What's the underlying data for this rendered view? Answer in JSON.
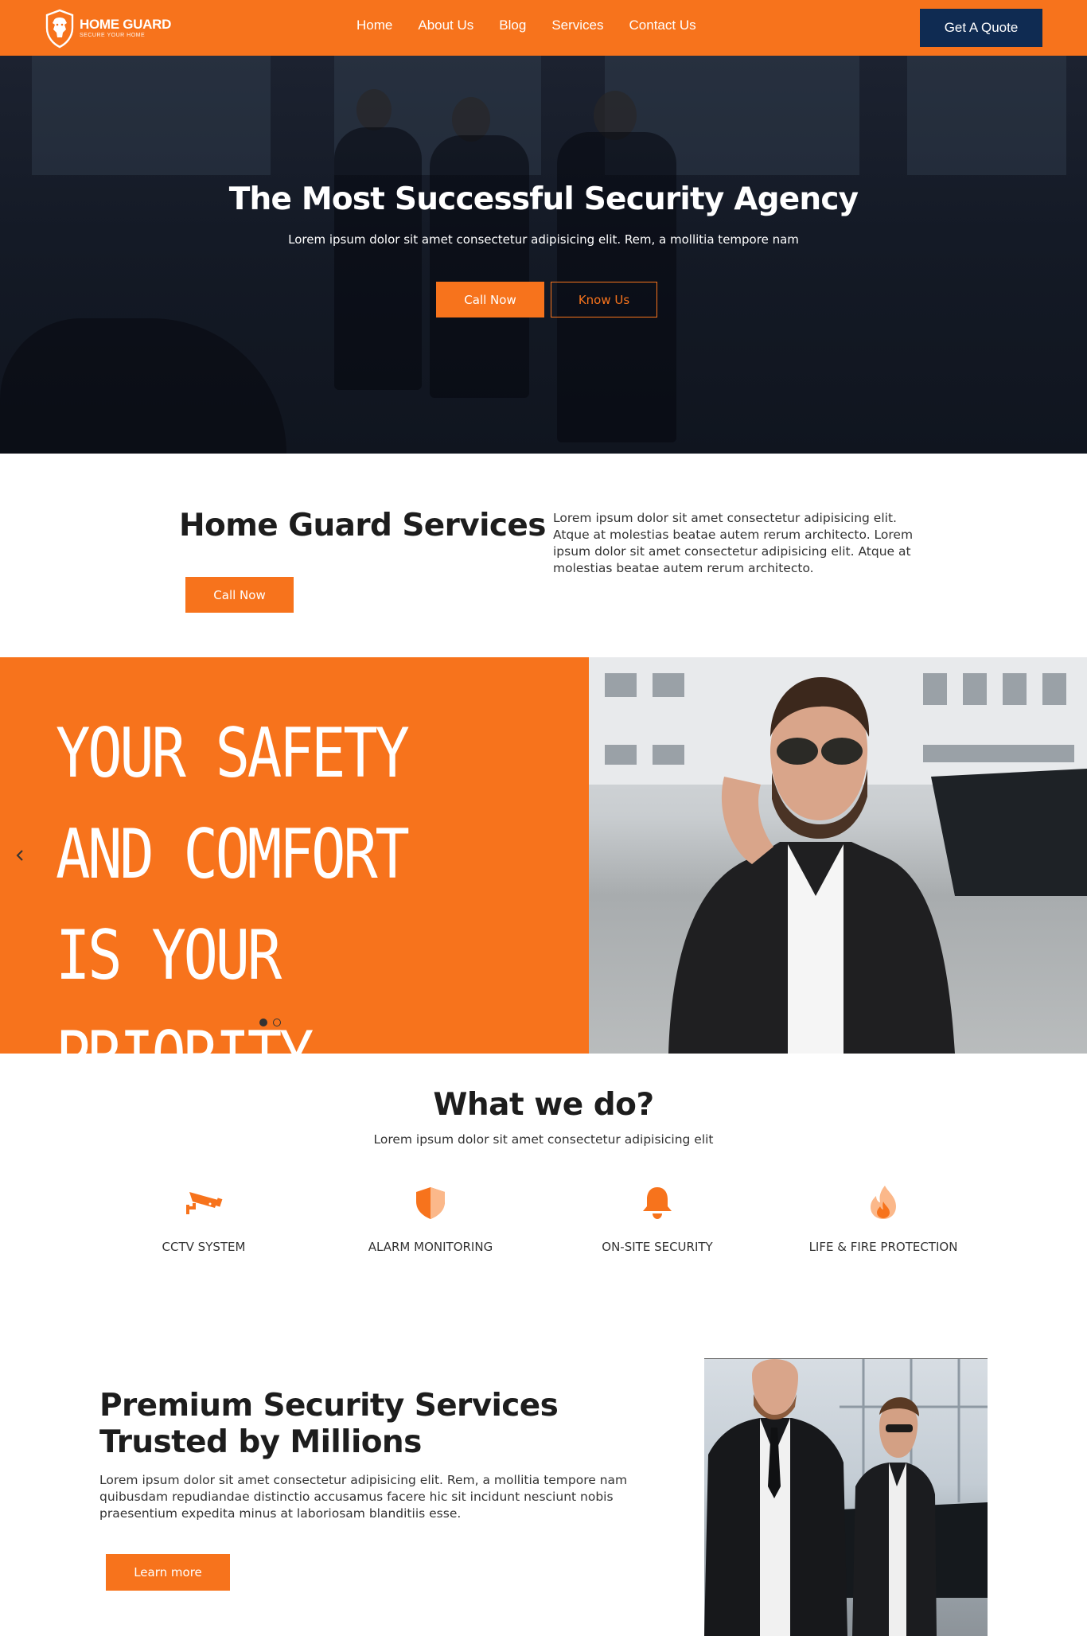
{
  "brand": {
    "name": "HOME GUARD",
    "tagline": "SECURE YOUR HOME",
    "accent": "#f7731c",
    "navy": "#0f2b52"
  },
  "nav": {
    "links": [
      "Home",
      "About Us",
      "Blog",
      "Services",
      "Contact Us"
    ],
    "quote_label": "Get A Quote"
  },
  "hero": {
    "title": "The Most Successful Security Agency",
    "subtitle": "Lorem ipsum dolor sit amet consectetur adipisicing elit. Rem, a mollitia tempore nam",
    "primary_cta": "Call Now",
    "secondary_cta": "Know Us"
  },
  "services_intro": {
    "title": "Home Guard Services",
    "text": "Lorem ipsum dolor sit amet consectetur adipisicing elit. Atque at molestias beatae autem rerum architecto. Lorem ipsum dolor sit amet consectetur adipisicing elit. Atque at molestias beatae autem rerum architecto.",
    "cta": "Call Now"
  },
  "carousel": {
    "lines": [
      "YOUR SAFETY",
      "AND COMFORT",
      "IS YOUR PRIORITY"
    ],
    "prev_icon": "chevron-left-icon",
    "slide_count": 2,
    "active_slide": 1
  },
  "what_we_do": {
    "title": "What we do?",
    "subtitle": "Lorem ipsum dolor sit amet consectetur adipisicing elit",
    "features": [
      {
        "label": "CCTV SYSTEM",
        "icon": "cctv-camera-icon"
      },
      {
        "label": "ALARM MONITORING",
        "icon": "shield-icon"
      },
      {
        "label": "ON-SITE SECURITY",
        "icon": "bell-icon"
      },
      {
        "label": "LIFE & FIRE PROTECTION",
        "icon": "fire-icon"
      }
    ]
  },
  "premium": {
    "title": "Premium Security Services Trusted by Millions",
    "text": "Lorem ipsum dolor sit amet consectetur adipisicing elit. Rem, a mollitia tempore nam quibusdam repudiandae distinctio accusamus facere hic sit incidunt nesciunt nobis praesentium expedita minus at laboriosam blanditiis esse.",
    "cta": "Learn more"
  }
}
